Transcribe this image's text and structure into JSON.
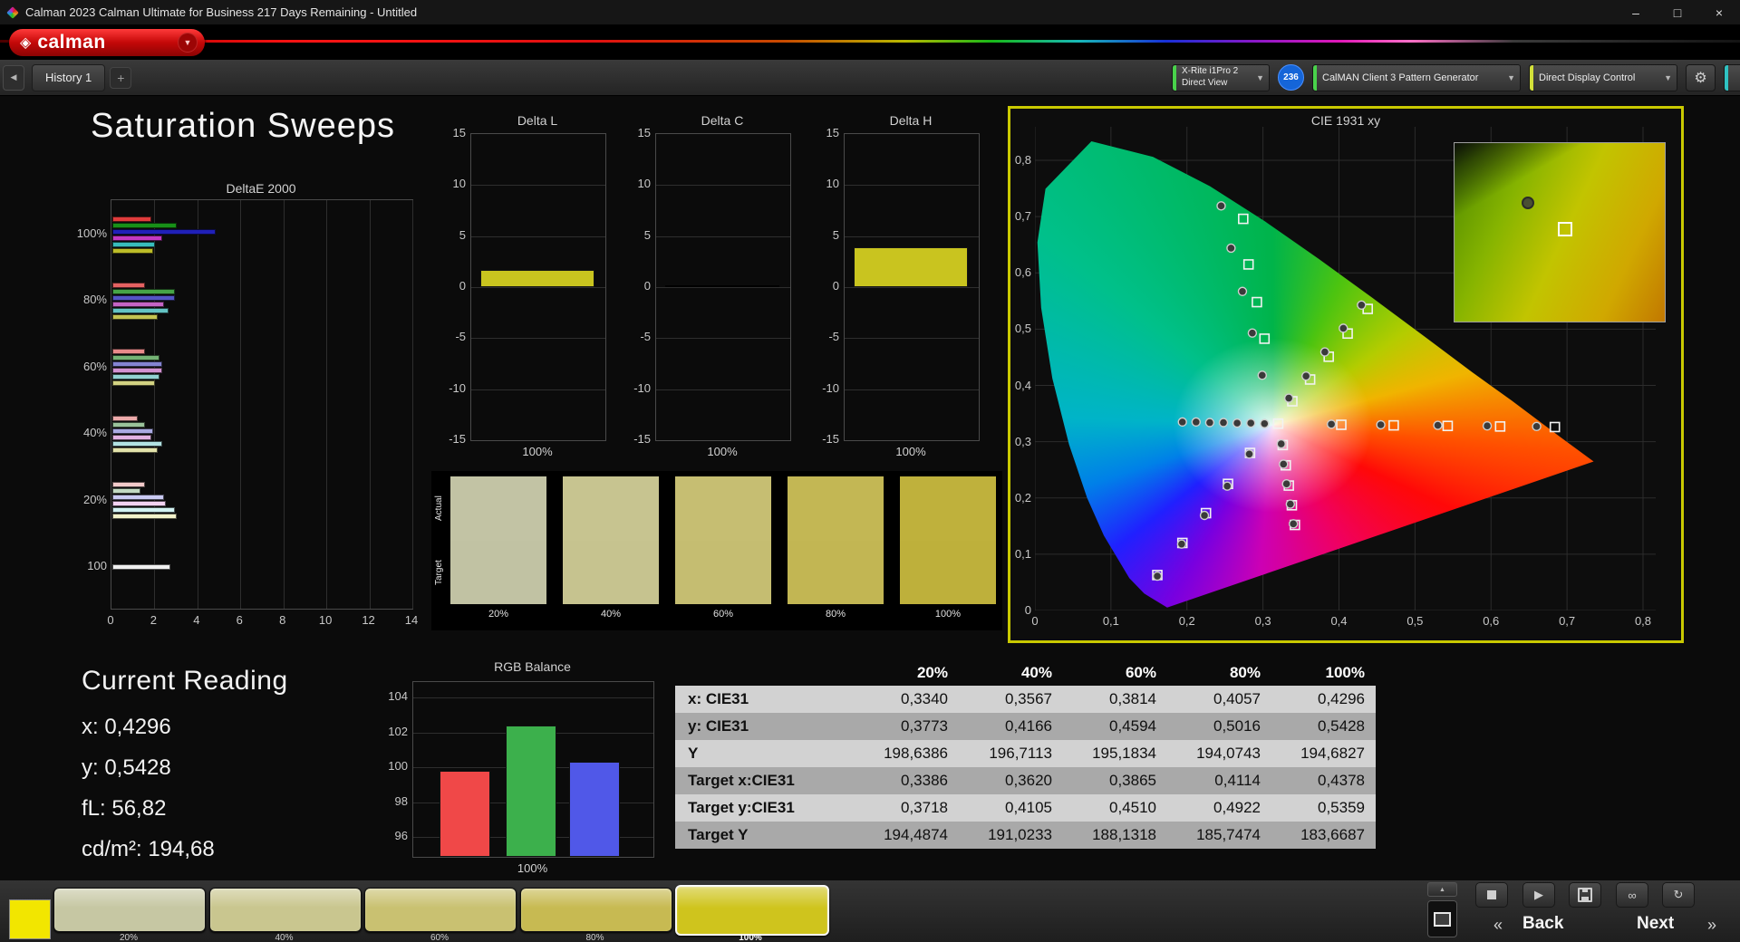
{
  "window": {
    "title": "Calman 2023 Calman Ultimate for Business 217 Days Remaining  - Untitled",
    "controls": {
      "minimize": "–",
      "maximize": "□",
      "close": "×"
    }
  },
  "brand": {
    "logo_text": "calman"
  },
  "tab_bar": {
    "history_tab": "History 1",
    "add_tab": "+"
  },
  "device_bar": {
    "meter": {
      "line1": "X-Rite i1Pro 2",
      "line2": "Direct View",
      "accent": "#49d24b"
    },
    "badge": "236",
    "pattern_generator": {
      "label": "CalMAN Client 3 Pattern Generator",
      "accent": "#49d24b"
    },
    "display_control": {
      "label": "Direct Display Control",
      "accent": "#d3e139"
    },
    "partial_accent": "#2fc2c2"
  },
  "page": {
    "title": "Saturation Sweeps"
  },
  "current_reading": {
    "title": "Current Reading",
    "lines": [
      {
        "text": "x: 0,4296"
      },
      {
        "text": "y: 0,5428"
      },
      {
        "text": "fL: 56,82"
      },
      {
        "text": "cd/m²: 194,68"
      }
    ]
  },
  "patch_strip": {
    "row_labels": [
      "Actual",
      "Target"
    ],
    "columns": [
      "20%",
      "40%",
      "60%",
      "80%",
      "100%"
    ],
    "actual_colors": [
      "#c2c3a4",
      "#c7c490",
      "#c6be72",
      "#c3b754",
      "#bfb13c"
    ],
    "target_colors": [
      "#c1c2a3",
      "#c6c38f",
      "#c5bd71",
      "#c2b653",
      "#beb03b"
    ]
  },
  "results_table": {
    "columns": [
      "20%",
      "40%",
      "60%",
      "80%",
      "100%"
    ],
    "rows": [
      {
        "label": "x: CIE31",
        "values": [
          "0,3340",
          "0,3567",
          "0,3814",
          "0,4057",
          "0,4296"
        ]
      },
      {
        "label": "y: CIE31",
        "values": [
          "0,3773",
          "0,4166",
          "0,4594",
          "0,5016",
          "0,5428"
        ]
      },
      {
        "label": "Y",
        "values": [
          "198,6386",
          "196,7113",
          "195,1834",
          "194,0743",
          "194,6827"
        ]
      },
      {
        "label": "Target x:CIE31",
        "values": [
          "0,3386",
          "0,3620",
          "0,3865",
          "0,4114",
          "0,4378"
        ]
      },
      {
        "label": "Target y:CIE31",
        "values": [
          "0,3718",
          "0,4105",
          "0,4510",
          "0,4922",
          "0,5359"
        ]
      },
      {
        "label": "Target Y",
        "values": [
          "194,4874",
          "191,0233",
          "188,1318",
          "185,7474",
          "183,6687"
        ]
      }
    ]
  },
  "bottom_bar": {
    "swatch_color": "#f2e600",
    "patches": [
      {
        "label": "20%",
        "color": "#c6c7a3",
        "selected": false
      },
      {
        "label": "40%",
        "color": "#c9c68f",
        "selected": false
      },
      {
        "label": "60%",
        "color": "#c9c171",
        "selected": false
      },
      {
        "label": "80%",
        "color": "#c7ba52",
        "selected": false
      },
      {
        "label": "100%",
        "color": "#cfc41d",
        "selected": true
      }
    ],
    "back_label": "Back",
    "next_label": "Next"
  },
  "chart_data": [
    {
      "id": "delta-e-2000",
      "type": "bar",
      "orientation": "horizontal",
      "title": "DeltaE 2000",
      "xlim": [
        0,
        14
      ],
      "xticks": [
        0,
        2,
        4,
        6,
        8,
        10,
        12,
        14
      ],
      "groups": [
        {
          "label": "100%",
          "values": [
            1.8,
            3.0,
            4.8,
            2.3,
            2.0,
            1.9
          ],
          "colors": [
            "#e03c3c",
            "#189018",
            "#2020b8",
            "#c238c2",
            "#38bcbc",
            "#bcbc28"
          ]
        },
        {
          "label": "80%",
          "values": [
            1.5,
            2.9,
            2.9,
            2.4,
            2.6,
            2.1
          ],
          "colors": [
            "#e46262",
            "#46a446",
            "#5454c4",
            "#c464c4",
            "#64c4c4",
            "#c4c452"
          ]
        },
        {
          "label": "60%",
          "values": [
            1.5,
            2.2,
            2.3,
            2.3,
            2.2,
            2.0
          ],
          "colors": [
            "#e88a8a",
            "#74b274",
            "#8484d2",
            "#d292d2",
            "#92d2d2",
            "#d2d282"
          ]
        },
        {
          "label": "40%",
          "values": [
            1.2,
            1.5,
            1.9,
            1.8,
            2.3,
            2.1
          ],
          "colors": [
            "#ecaaaa",
            "#9ac29a",
            "#aaaae2",
            "#e2b2e2",
            "#b2e2e2",
            "#e2e2aa"
          ]
        },
        {
          "label": "20%",
          "values": [
            1.5,
            1.3,
            2.4,
            2.5,
            2.9,
            3.0
          ],
          "colors": [
            "#f2caca",
            "#c2dac2",
            "#cacaf2",
            "#f2d2f2",
            "#d2f2f2",
            "#f2f2ca"
          ]
        },
        {
          "label": "100",
          "values": [
            2.7
          ],
          "colors": [
            "#f0f0f0"
          ]
        }
      ]
    },
    {
      "id": "delta-l",
      "type": "bar",
      "title": "Delta L",
      "ylim": [
        -15,
        15
      ],
      "yticks": [
        15,
        10,
        5,
        0,
        -5,
        -10,
        -15
      ],
      "categories": [
        "100%"
      ],
      "values": [
        1.7
      ],
      "bar_color": "#c9c41f",
      "xlabel": "100%"
    },
    {
      "id": "delta-c",
      "type": "bar",
      "title": "Delta C",
      "ylim": [
        -15,
        15
      ],
      "yticks": [
        15,
        10,
        5,
        0,
        -5,
        -10,
        -15
      ],
      "categories": [
        "100%"
      ],
      "values": [
        0.0
      ],
      "bar_color": "#c9c41f",
      "xlabel": "100%"
    },
    {
      "id": "delta-h",
      "type": "bar",
      "title": "Delta H",
      "ylim": [
        -15,
        15
      ],
      "yticks": [
        15,
        10,
        5,
        0,
        -5,
        -10,
        -15
      ],
      "categories": [
        "100%"
      ],
      "values": [
        3.9
      ],
      "bar_color": "#c9c41f",
      "xlabel": "100%"
    },
    {
      "id": "cie-1931",
      "type": "scatter",
      "title": "CIE 1931 xy",
      "xlim": [
        0,
        0.8
      ],
      "ylim": [
        0,
        0.8
      ],
      "xticks": [
        "0",
        "0,1",
        "0,2",
        "0,3",
        "0,4",
        "0,5",
        "0,6",
        "0,7",
        "0,8"
      ],
      "yticks": [
        "0",
        "0,1",
        "0,2",
        "0,3",
        "0,4",
        "0,5",
        "0,6",
        "0,7",
        "0,8"
      ],
      "measured": [
        [
          0.194,
          0.335
        ],
        [
          0.212,
          0.335
        ],
        [
          0.23,
          0.334
        ],
        [
          0.248,
          0.334
        ],
        [
          0.266,
          0.333
        ],
        [
          0.284,
          0.333
        ],
        [
          0.302,
          0.332
        ],
        [
          0.245,
          0.719
        ],
        [
          0.258,
          0.644
        ],
        [
          0.273,
          0.567
        ],
        [
          0.286,
          0.493
        ],
        [
          0.299,
          0.418
        ],
        [
          0.334,
          0.3773
        ],
        [
          0.3567,
          0.4166
        ],
        [
          0.3814,
          0.4594
        ],
        [
          0.4057,
          0.5016
        ],
        [
          0.4296,
          0.5428
        ],
        [
          0.39,
          0.331
        ],
        [
          0.455,
          0.33
        ],
        [
          0.53,
          0.329
        ],
        [
          0.595,
          0.328
        ],
        [
          0.66,
          0.327
        ],
        [
          0.324,
          0.296
        ],
        [
          0.327,
          0.26
        ],
        [
          0.331,
          0.225
        ],
        [
          0.336,
          0.189
        ],
        [
          0.34,
          0.154
        ],
        [
          0.282,
          0.278
        ],
        [
          0.253,
          0.221
        ],
        [
          0.223,
          0.169
        ],
        [
          0.193,
          0.118
        ],
        [
          0.161,
          0.061
        ]
      ],
      "targets": [
        [
          0.32,
          0.332
        ],
        [
          0.274,
          0.696
        ],
        [
          0.281,
          0.615
        ],
        [
          0.292,
          0.548
        ],
        [
          0.302,
          0.483
        ],
        [
          0.3386,
          0.3718
        ],
        [
          0.362,
          0.4105
        ],
        [
          0.3865,
          0.451
        ],
        [
          0.4114,
          0.4922
        ],
        [
          0.4378,
          0.5359
        ],
        [
          0.403,
          0.33
        ],
        [
          0.472,
          0.329
        ],
        [
          0.543,
          0.328
        ],
        [
          0.612,
          0.327
        ],
        [
          0.684,
          0.326
        ],
        [
          0.283,
          0.28
        ],
        [
          0.254,
          0.225
        ],
        [
          0.225,
          0.173
        ],
        [
          0.194,
          0.12
        ],
        [
          0.161,
          0.063
        ],
        [
          0.326,
          0.294
        ],
        [
          0.33,
          0.258
        ],
        [
          0.334,
          0.222
        ],
        [
          0.338,
          0.187
        ],
        [
          0.342,
          0.152
        ]
      ]
    },
    {
      "id": "rgb-balance",
      "type": "bar",
      "title": "RGB Balance",
      "ylim": [
        96,
        104
      ],
      "yticks": [
        104,
        102,
        100,
        98,
        96
      ],
      "categories": [
        "Red",
        "Green",
        "Blue"
      ],
      "values": [
        99.8,
        102.4,
        100.3
      ],
      "colors": [
        "#f04848",
        "#3cb04c",
        "#5058e8"
      ],
      "xlabel": "100%"
    }
  ]
}
